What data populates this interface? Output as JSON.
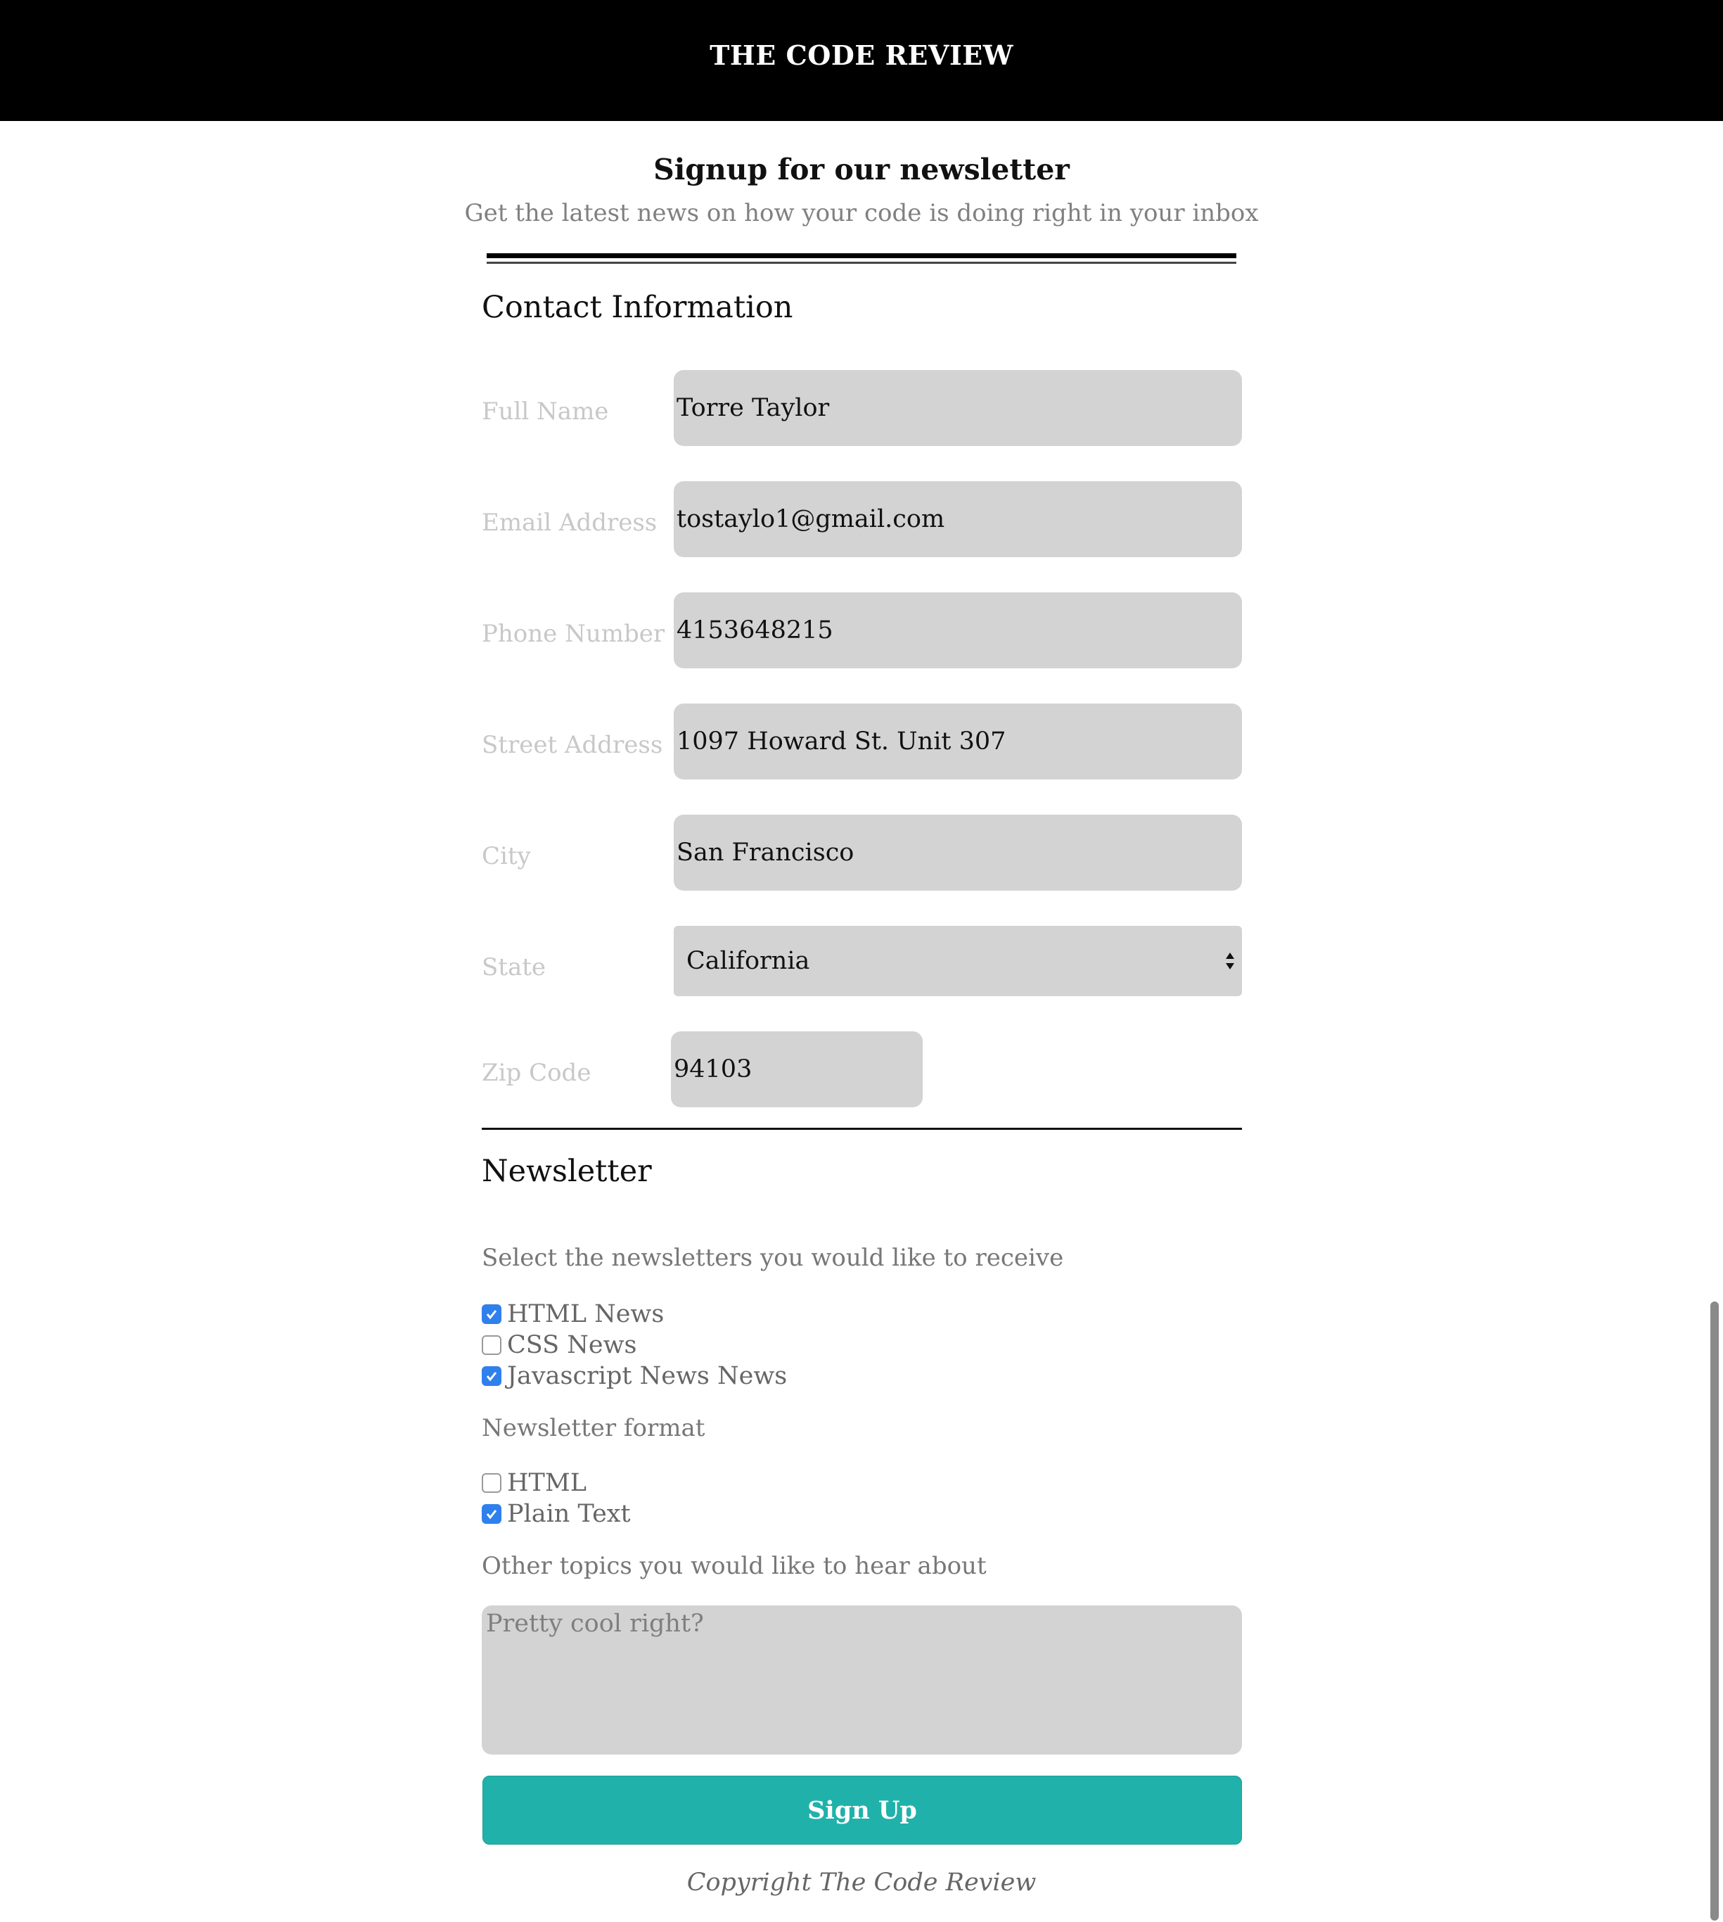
{
  "header": {
    "title": "THE CODE REVIEW"
  },
  "intro": {
    "title": "Signup for our newsletter",
    "subtitle": "Get the latest news on how your code is doing right in your inbox"
  },
  "contact": {
    "heading": "Contact Information",
    "fields": [
      {
        "label": "Full Name",
        "value": "Torre Taylor"
      },
      {
        "label": "Email Address",
        "value": "tostaylo1@gmail.com"
      },
      {
        "label": "Phone Number",
        "value": "4153648215"
      },
      {
        "label": "Street Address",
        "value": "1097 Howard St. Unit 307"
      },
      {
        "label": "City",
        "value": "San Francisco"
      },
      {
        "label": "State",
        "value": "California"
      },
      {
        "label": "Zip Code",
        "value": "94103"
      }
    ]
  },
  "newsletter": {
    "heading": "Newsletter",
    "select_prompt": "Select the newsletters you would like to receive",
    "options": [
      {
        "label": "HTML News",
        "checked": true
      },
      {
        "label": "CSS News",
        "checked": false
      },
      {
        "label": "Javascript News News",
        "checked": true
      }
    ],
    "format_prompt": "Newsletter format",
    "formats": [
      {
        "label": "HTML",
        "checked": false
      },
      {
        "label": "Plain Text",
        "checked": true
      }
    ],
    "topics_prompt": "Other topics you would like to hear about",
    "topics_placeholder": "Pretty cool right?",
    "submit_label": "Sign Up"
  },
  "footer": {
    "copyright": "Copyright The Code Review"
  },
  "colors": {
    "header_bg": "#000000",
    "field_bg": "#d3d3d3",
    "button_bg": "#20b2aa",
    "checkbox_checked": "#2f80ed"
  }
}
